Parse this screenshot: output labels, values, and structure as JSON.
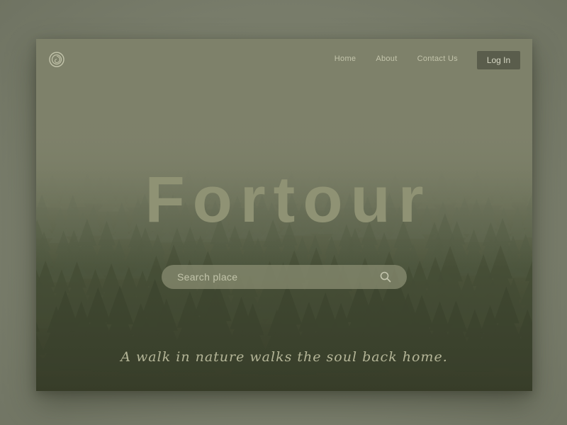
{
  "brand": {
    "logo_icon": "spiral-logo-icon",
    "title": "Fortour"
  },
  "nav": {
    "items": [
      {
        "label": "Home"
      },
      {
        "label": "About"
      },
      {
        "label": "Contact Us"
      }
    ],
    "login_label": "Log In"
  },
  "search": {
    "placeholder": "Search place",
    "icon": "search-icon"
  },
  "tagline": "A walk in nature walks the soul back home.",
  "colors": {
    "background": "#7c806e",
    "title": "#8f9274",
    "login_button": "#5a5d4c",
    "nav_text": "#c3c4ab"
  }
}
